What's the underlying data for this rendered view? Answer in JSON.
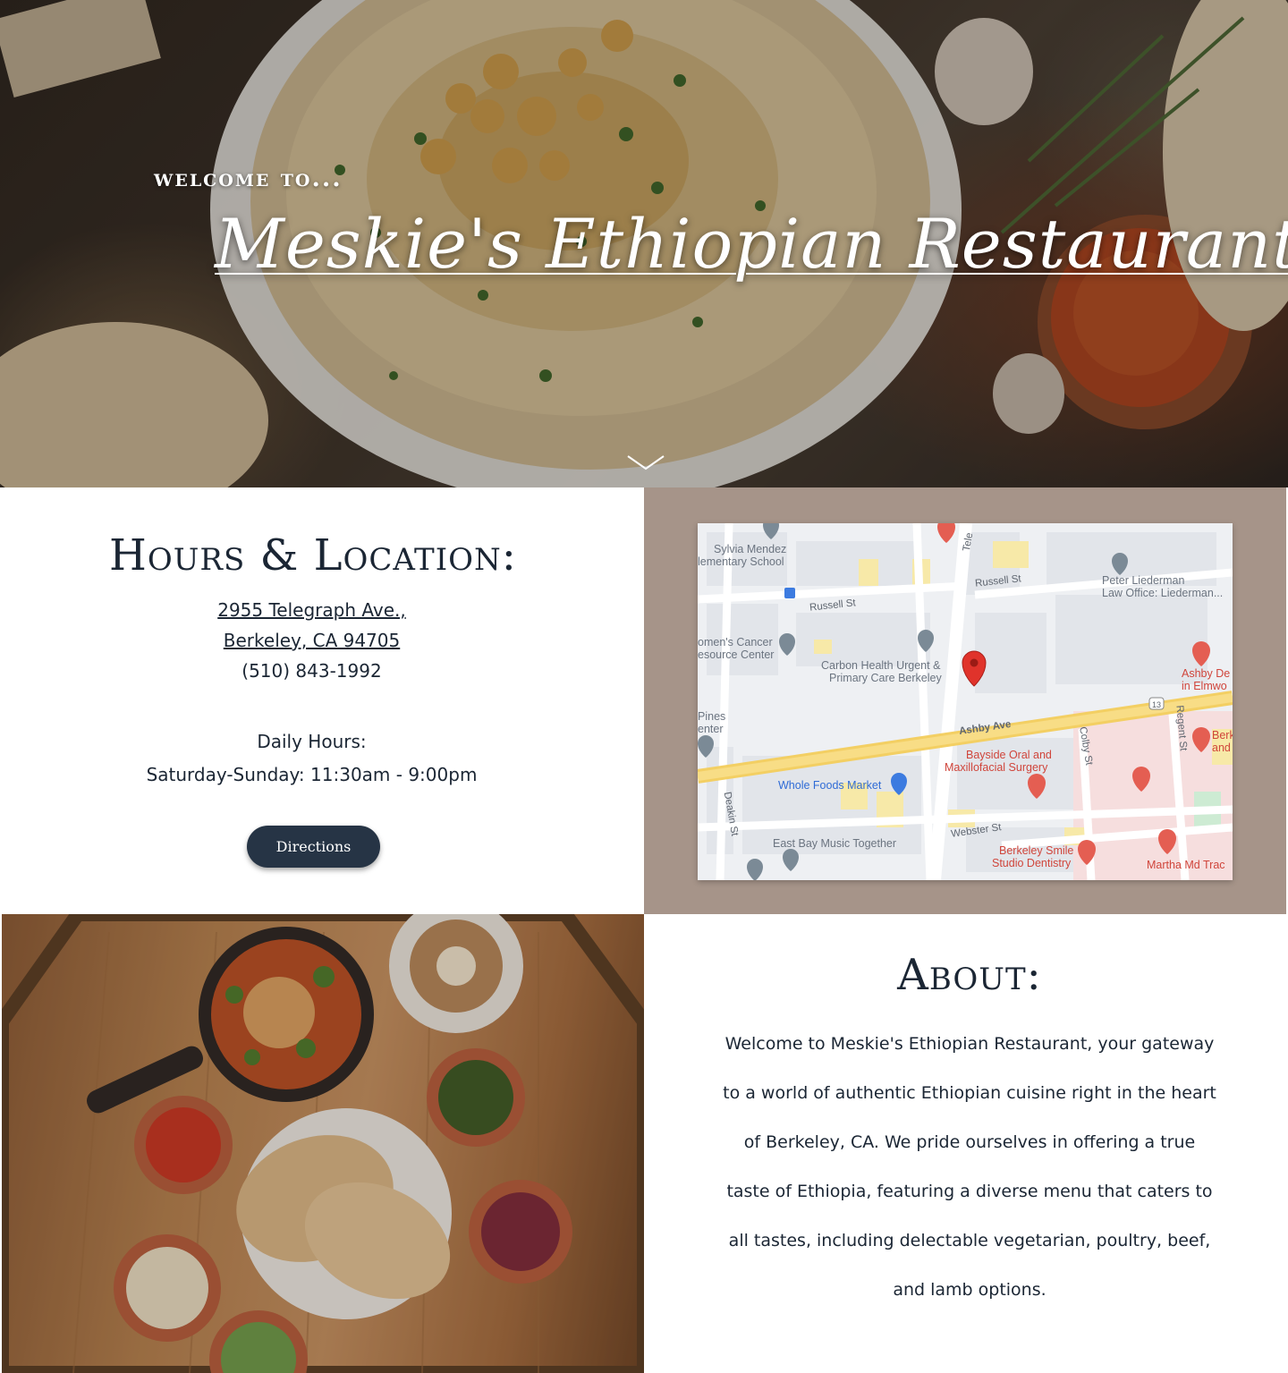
{
  "hero": {
    "welcome": "welcome to...",
    "title": "Meskie's Ethiopian Restaurant",
    "scroll_icon": "chevron-down-icon"
  },
  "hours": {
    "heading": "Hours & Location:",
    "address_line1": "2955 Telegraph Ave., ",
    "address_line2": "Berkeley, CA 94705",
    "phone": "(510) 843-1992",
    "daily_hours_label": "Daily Hours:",
    "hours_line": "Saturday-Sunday: 11:30am - 9:00pm",
    "directions_label": "Directions",
    "button_color": "#263445"
  },
  "map": {
    "panel_color": "#a69489",
    "labels": {
      "sylvia_1": "Sylvia Mendez",
      "sylvia_2": "lementary School",
      "russell_1": "Russell St",
      "russell_2": "Russell St",
      "peter_1": "Peter Liederman",
      "peter_2": "Law Office: Liederman...",
      "womens_1": "omen's Cancer",
      "womens_2": "esource Center",
      "carbon_1": "Carbon Health Urgent &",
      "carbon_2": "Primary Care Berkeley",
      "ashby_dental_1": "Ashby De",
      "ashby_dental_2": "in Elmwo",
      "pines_1": "Pines",
      "pines_2": "enter",
      "ashby_ave": "Ashby Ave",
      "bayside_1": "Bayside Oral and",
      "bayside_2": "Maxillofacial Surgery",
      "colby": "Colby St",
      "regent": "Regent St",
      "berk_1": "Berk",
      "berk_2": "and",
      "whole_foods": "Whole Foods Market",
      "deakin": "Deakin St",
      "webster": "Webster St",
      "east_bay": "East Bay Music Together",
      "berkeley_smile_1": "Berkeley Smile",
      "berkeley_smile_2": "Studio Dentistry",
      "martha": "Martha Md Trac",
      "telegraph": "Tele",
      "route_13": "13"
    }
  },
  "about": {
    "heading": "About:",
    "body": "Welcome to Meskie's Ethiopian Restaurant, your gateway to a world of authentic Ethiopian cuisine right in the heart of Berkeley, CA. We pride ourselves in offering a true taste of Ethiopia, featuring a diverse menu that caters to all tastes, including delectable vegetarian, poultry, beef, and lamb options."
  }
}
